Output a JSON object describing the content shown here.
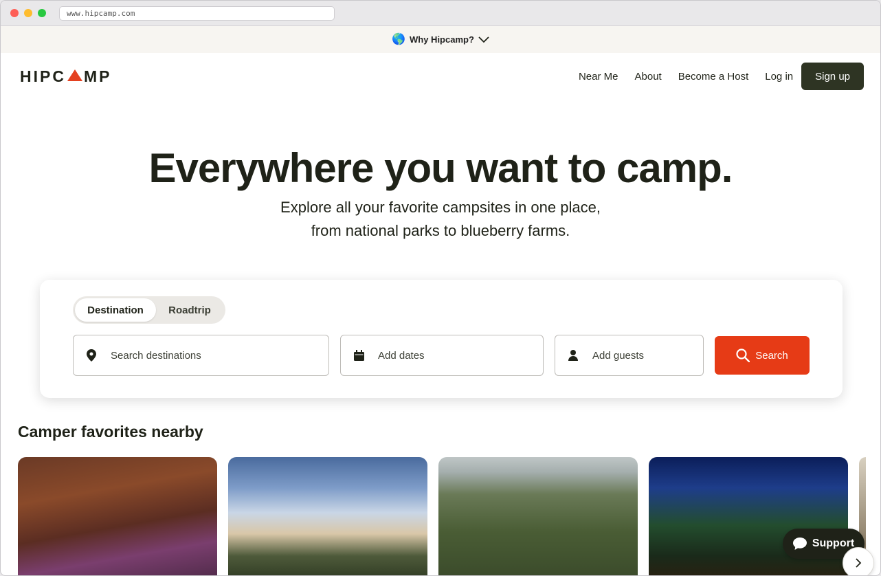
{
  "browser": {
    "url": "www.hipcamp.com"
  },
  "banner": {
    "emoji": "🌎",
    "label": "Why Hipcamp?",
    "icon": "chevron-down-icon"
  },
  "header": {
    "logo": "HIPCAMP",
    "nav": [
      "Near Me",
      "About",
      "Become a Host",
      "Log in"
    ],
    "signup_label": "Sign up"
  },
  "hero": {
    "title": "Everywhere you want to camp.",
    "subtitle_line1": "Explore all your favorite campsites in one place,",
    "subtitle_line2": "from national parks to blueberry farms."
  },
  "search": {
    "tabs": [
      "Destination",
      "Roadtrip"
    ],
    "active_tab": "Destination",
    "destination_placeholder": "Search destinations",
    "dates_placeholder": "Add dates",
    "guests_placeholder": "Add guests",
    "button_label": "Search",
    "button_color": "#e63b16"
  },
  "section": {
    "title": "Camper favorites nearby"
  },
  "support": {
    "label": "Support"
  },
  "colors": {
    "brand_dark": "#2e3423",
    "accent": "#e63b16",
    "text": "#1f2218"
  }
}
